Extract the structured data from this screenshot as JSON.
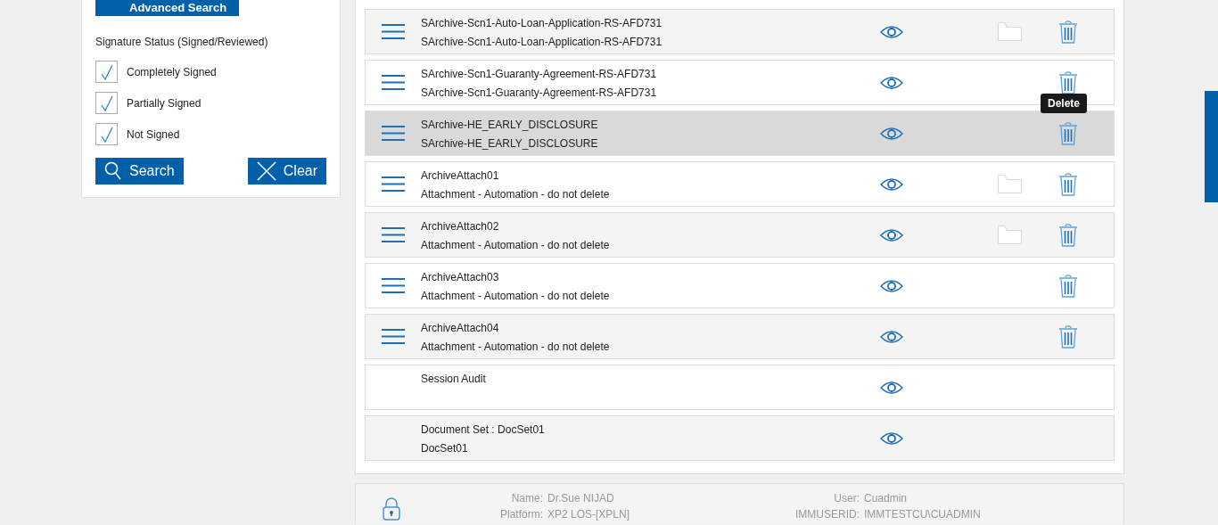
{
  "filter_panel": {
    "advanced_search_button": "Advanced Search",
    "signature_status_label": "Signature Status (Signed/Reviewed)",
    "checkboxes": [
      {
        "label": "Completely Signed",
        "checked": true
      },
      {
        "label": "Partially Signed",
        "checked": true
      },
      {
        "label": "Not Signed",
        "checked": true
      }
    ],
    "search_button": "Search",
    "clear_button": "Clear"
  },
  "documents": [
    {
      "line1": "SArchive-Scn1-Auto-Loan-Application-RS-AFD731",
      "line2": "SArchive-Scn1-Auto-Loan-Application-RS-AFD731",
      "has_menu": true,
      "has_folder": true,
      "has_delete": true,
      "highlighted": false
    },
    {
      "line1": "SArchive-Scn1-Guaranty-Agreement-RS-AFD731",
      "line2": "SArchive-Scn1-Guaranty-Agreement-RS-AFD731",
      "has_menu": true,
      "has_folder": false,
      "has_delete": true,
      "highlighted": false
    },
    {
      "line1": "SArchive-HE_EARLY_DISCLOSURE",
      "line2": "SArchive-HE_EARLY_DISCLOSURE",
      "has_menu": true,
      "has_folder": false,
      "has_delete": true,
      "highlighted": true,
      "tooltip": "Delete"
    },
    {
      "line1": "ArchiveAttach01",
      "line2": "Attachment - Automation - do not delete",
      "has_menu": true,
      "has_folder": true,
      "has_delete": true,
      "highlighted": false
    },
    {
      "line1": "ArchiveAttach02",
      "line2": "Attachment - Automation - do not delete",
      "has_menu": true,
      "has_folder": true,
      "has_delete": true,
      "highlighted": false
    },
    {
      "line1": "ArchiveAttach03",
      "line2": "Attachment - Automation - do not delete",
      "has_menu": true,
      "has_folder": false,
      "has_delete": true,
      "highlighted": false
    },
    {
      "line1": "ArchiveAttach04",
      "line2": "Attachment - Automation - do not delete",
      "has_menu": true,
      "has_folder": false,
      "has_delete": true,
      "highlighted": false
    },
    {
      "line1": "Session Audit",
      "has_menu": false,
      "has_folder": false,
      "has_delete": false,
      "highlighted": false
    },
    {
      "line1": "Document Set : DocSet01",
      "line2": "DocSet01",
      "has_menu": false,
      "has_folder": false,
      "has_delete": false,
      "highlighted": false
    }
  ],
  "footer": {
    "left": [
      {
        "label": "Name:",
        "value": "Dr.Sue NIJAD"
      },
      {
        "label": "Platform:",
        "value": "XP2 LOS-[XPLN]"
      }
    ],
    "right": [
      {
        "label": "User:",
        "value": "Cuadmin"
      },
      {
        "label": "IMMUSERID:",
        "value": "IMMTESTCU\\CUADMIN"
      }
    ]
  }
}
